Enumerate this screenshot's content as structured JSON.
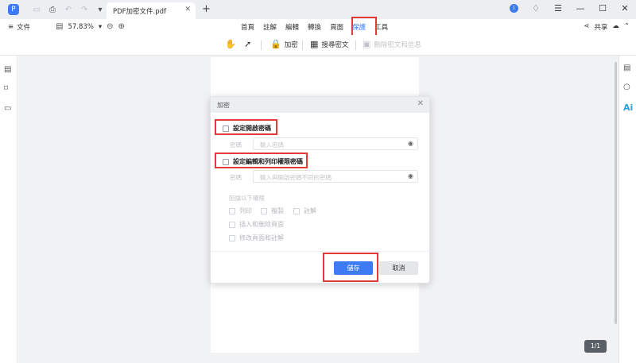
{
  "app": {
    "logo_glyph": "P",
    "doc_tab_title": "PDF加密文件.pdf",
    "new_tab": "+",
    "user_badge": "i"
  },
  "menubar": {
    "file_label": "文件",
    "zoom_value": "57.83%",
    "tabs": [
      "首頁",
      "註解",
      "編輯",
      "轉換",
      "頁面",
      "保護",
      "工具"
    ],
    "active_tab": "保護",
    "share_label": "共享"
  },
  "toolbar": {
    "encrypt_label": "加密",
    "redact_label": "搜尋密文",
    "disabled_label": "刪除密文和信息"
  },
  "status": {
    "page_indicator": "1/1"
  },
  "dialog": {
    "title": "加密",
    "open_password_option": "設定開啟密碼",
    "open_password_field_label": "密碼",
    "open_password_placeholder": "輸入密碼",
    "permission_password_option": "設定編輯和列印權限密碼",
    "permission_password_field_label": "密碼",
    "permission_password_placeholder": "輸入與開啟密碼不同的密碼",
    "permissions_heading": "阻擋以下權限",
    "permission_options": [
      "列印",
      "複製",
      "註解"
    ],
    "extra_options": [
      "插入和刪除頁面",
      "修改頁面和註解"
    ],
    "save_button": "儲存",
    "cancel_button": "取消"
  },
  "colors": {
    "accent": "#3d7bf5",
    "highlight": "#e53935",
    "ai": "#2aa3e0"
  },
  "icons": {
    "hand": "hand-icon",
    "cursor": "cursor-icon",
    "lock": "lock-icon",
    "eye": "eye-icon"
  }
}
